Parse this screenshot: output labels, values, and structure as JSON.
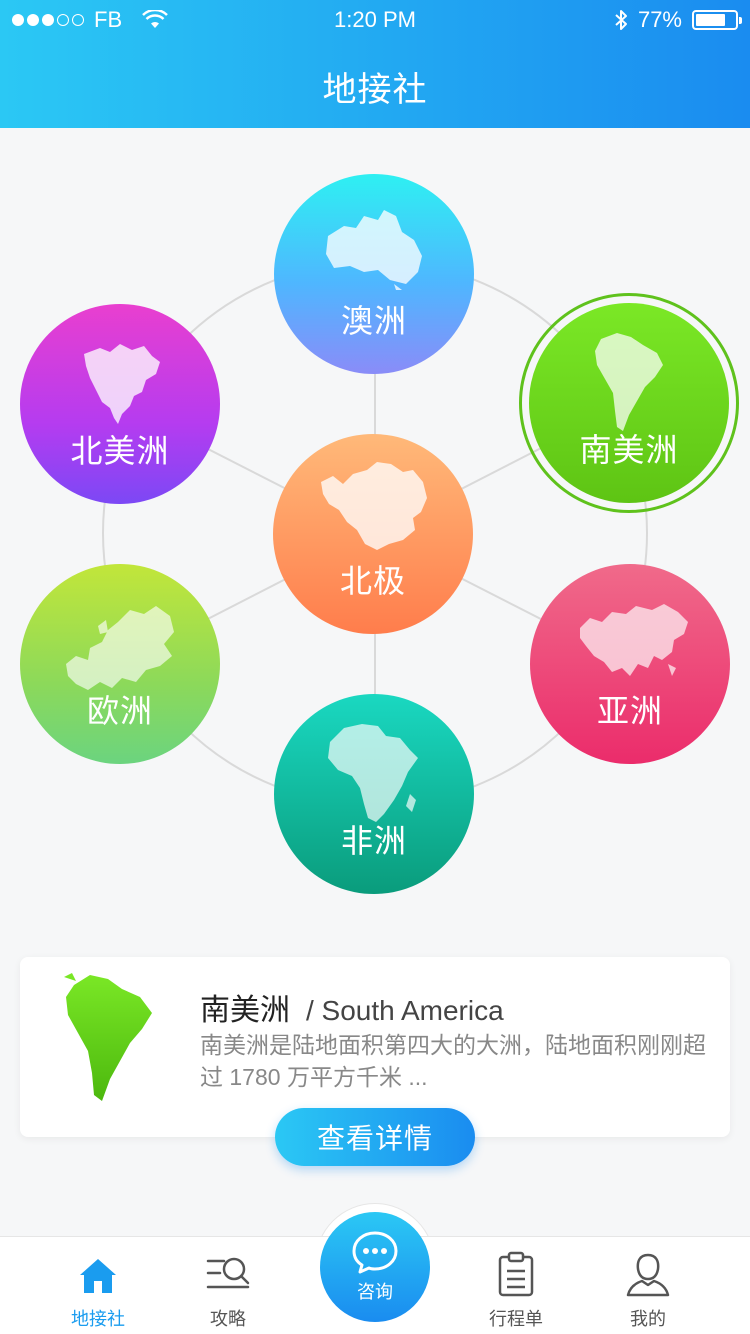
{
  "status_bar": {
    "carrier": "FB",
    "time": "1:20 PM",
    "battery": "77%",
    "battery_level": 0.77
  },
  "header": {
    "title": "地接社"
  },
  "continents": [
    {
      "id": "aozhou",
      "label": "澳洲",
      "icon": "australia-map-icon"
    },
    {
      "id": "beimei",
      "label": "北美洲",
      "icon": "north-america-map-icon"
    },
    {
      "id": "nanmei",
      "label": "南美洲",
      "icon": "south-america-map-icon",
      "selected": true
    },
    {
      "id": "beiji",
      "label": "北极",
      "icon": "antarctica-map-icon"
    },
    {
      "id": "ouzhou",
      "label": "欧洲",
      "icon": "europe-map-icon"
    },
    {
      "id": "yazhou",
      "label": "亚洲",
      "icon": "asia-map-icon"
    },
    {
      "id": "feizhou",
      "label": "非洲",
      "icon": "africa-map-icon"
    }
  ],
  "info_card": {
    "title_zh": "南美洲",
    "title_en": "/ South America",
    "description": "南美洲是陆地面积第四大的大洲，陆地面积刚刚超过 1780 万平方千米 ...",
    "button_label": "查看详情"
  },
  "tabbar": {
    "home": "地接社",
    "guide": "攻略",
    "consult": "咨询",
    "trip": "行程单",
    "mine": "我的"
  },
  "colors": {
    "primary": "#1a8cf0",
    "accent_cyan": "#2bc8f4",
    "selected_ring": "#5fc21c"
  }
}
